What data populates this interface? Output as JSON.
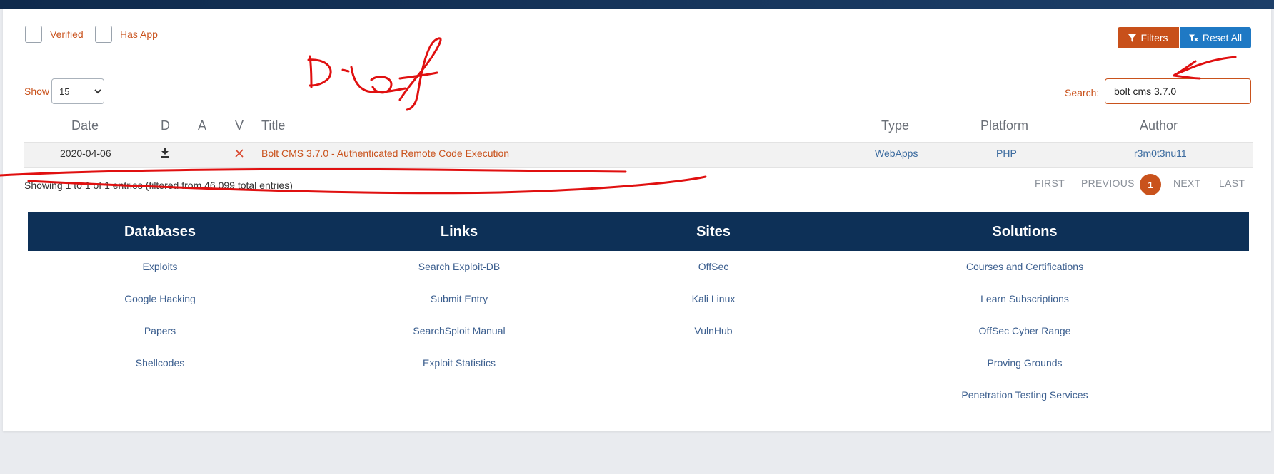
{
  "filters": {
    "verified_label": "Verified",
    "has_app_label": "Has App"
  },
  "toolbar": {
    "filters_label": "Filters",
    "reset_label": "Reset All"
  },
  "show": {
    "label": "Show",
    "value": "15"
  },
  "search": {
    "label": "Search:",
    "value": "bolt cms 3.7.0"
  },
  "table": {
    "headers": {
      "date": "Date",
      "d": "D",
      "a": "A",
      "v": "V",
      "title": "Title",
      "type": "Type",
      "platform": "Platform",
      "author": "Author"
    },
    "rows": [
      {
        "date": "2020-04-06",
        "title": "Bolt CMS 3.7.0 - Authenticated Remote Code Execution",
        "type": "WebApps",
        "platform": "PHP",
        "author": "r3m0t3nu11",
        "download_icon": "download-icon",
        "verified_icon": "x-icon"
      }
    ]
  },
  "info": "Showing 1 to 1 of 1 entries (filtered from 46,099 total entries)",
  "pagination": {
    "first": "FIRST",
    "previous": "PREVIOUS",
    "current": "1",
    "next": "NEXT",
    "last": "LAST"
  },
  "footer": {
    "columns": [
      {
        "heading": "Databases",
        "links": [
          "Exploits",
          "Google Hacking",
          "Papers",
          "Shellcodes"
        ]
      },
      {
        "heading": "Links",
        "links": [
          "Search Exploit-DB",
          "Submit Entry",
          "SearchSploit Manual",
          "Exploit Statistics"
        ]
      },
      {
        "heading": "Sites",
        "links": [
          "OffSec",
          "Kali Linux",
          "VulnHub"
        ]
      },
      {
        "heading": "Solutions",
        "links": [
          "Courses and Certifications",
          "Learn Subscriptions",
          "OffSec Cyber Range",
          "Proving Grounds",
          "Penetration Testing Services"
        ]
      }
    ]
  },
  "colors": {
    "accent": "#c9521c",
    "blue_button": "#1f79c4",
    "footer_bg": "#0d3057",
    "annotation": "#e01010"
  }
}
